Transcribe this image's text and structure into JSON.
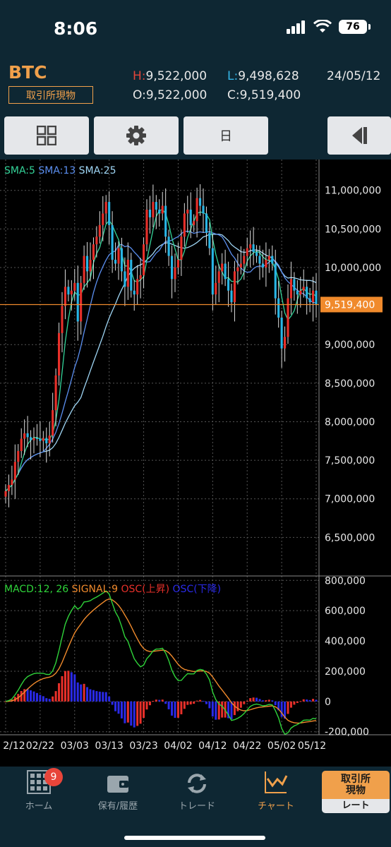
{
  "status": {
    "time": "8:06",
    "battery": "76"
  },
  "header": {
    "symbol": "BTC",
    "market": "取引所現物",
    "high_label": "H:",
    "high": "9,522,000",
    "low_label": "L:",
    "low": "9,498,628",
    "open_label": "O:",
    "open": "9,522,000",
    "close_label": "C:",
    "close": "9,519,400",
    "date": "24/05/12"
  },
  "toolbar": {
    "period_label": "日"
  },
  "indicators": {
    "sma5": "SMA:5",
    "sma13": "SMA:13",
    "sma25": "SMA:25",
    "macd": "MACD:12, 26",
    "signal": "SIGNAL:9",
    "osc_up": "OSC(上昇)",
    "osc_down": "OSC(下降)"
  },
  "colors": {
    "up": "#e8302a",
    "down": "#29b6e6",
    "sma5": "#34d399",
    "sma13": "#5b8ff0",
    "sma25": "#9fd6f5",
    "macd": "#2fd33a",
    "signal": "#f08a2c",
    "price_line": "#f08a2c",
    "accent": "#f0a04b"
  },
  "chart_data": [
    {
      "type": "line",
      "subtype": "candlestick",
      "price_label": "9,519,400",
      "y_ticks": [
        "11,000,000",
        "10,500,000",
        "10,000,000",
        "9,000,000",
        "8,500,000",
        "8,000,000",
        "7,500,000",
        "7,000,000",
        "6,500,000"
      ],
      "y_tick_values": [
        11000000,
        10500000,
        10000000,
        9000000,
        8500000,
        8000000,
        7500000,
        7000000,
        6500000
      ],
      "ylim": [
        6000000,
        11400000
      ],
      "x_ticks": [
        "2/12",
        "02/22",
        "03/03",
        "03/13",
        "03/23",
        "04/02",
        "04/12",
        "04/22",
        "05/02",
        "05/12"
      ],
      "last_price": 9519400,
      "closes": [
        7100000,
        7180000,
        7250000,
        7480000,
        7620000,
        7780000,
        7850000,
        7800000,
        7760000,
        7790000,
        7780000,
        7750000,
        7790000,
        7720000,
        7820000,
        8150000,
        8600000,
        9150000,
        9500000,
        9750000,
        9650000,
        9700000,
        9800000,
        9300000,
        9800000,
        10150000,
        9950000,
        10100000,
        10300000,
        10400000,
        10550000,
        10700000,
        10850000,
        10550000,
        10100000,
        10050000,
        10250000,
        9950000,
        9750000,
        10100000,
        9700000,
        9650000,
        9850000,
        9900000,
        10300000,
        10750000,
        10650000,
        10850000,
        10750000,
        10700000,
        10800000,
        10400000,
        10150000,
        9850000,
        10000000,
        10100000,
        10400000,
        10700000,
        10750000,
        10550000,
        10600000,
        10900000,
        10800000,
        10700000,
        10450000,
        10250000,
        9650000,
        9800000,
        9950000,
        10050000,
        9850000,
        9700000,
        9550000,
        9950000,
        10000000,
        10050000,
        10150000,
        10250000,
        10300000,
        10200000,
        10150000,
        10050000,
        10000000,
        10100000,
        10150000,
        10050000,
        9600000,
        9350000,
        8950000,
        9100000,
        9600000,
        9850000,
        9700000,
        9650000,
        9700000,
        9750000,
        9600000,
        9550000,
        9700000,
        9519400
      ]
    },
    {
      "type": "line",
      "subtype": "macd",
      "y_ticks": [
        "800,000",
        "600,000",
        "400,000",
        "200,000",
        "0",
        "-200,000"
      ],
      "y_tick_values": [
        800000,
        600000,
        400000,
        200000,
        0,
        -200000
      ],
      "ylim": [
        -220000,
        820000
      ],
      "x_ticks": [
        "2/12",
        "02/22",
        "03/03",
        "03/13",
        "03/23",
        "04/02",
        "04/12",
        "04/22",
        "05/02",
        "05/12"
      ]
    }
  ]
}
